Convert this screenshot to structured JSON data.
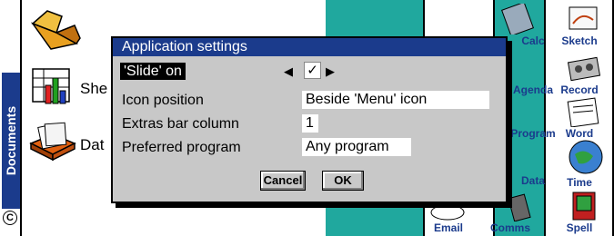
{
  "sidebar": {
    "label": "Documents",
    "corner_badge": "C"
  },
  "files": [
    {
      "label": "She",
      "icon": "spreadsheet-icon"
    },
    {
      "label": "Dat",
      "icon": "database-icon"
    }
  ],
  "folder_icon": "folder-icon",
  "apps": [
    {
      "label": "Calc",
      "icon": "calculator-icon"
    },
    {
      "label": "Sketch",
      "icon": "sketch-icon"
    },
    {
      "label": "Agenda",
      "icon": "agenda-icon"
    },
    {
      "label": "Record",
      "icon": "record-icon"
    },
    {
      "label": "Program",
      "icon": "program-icon"
    },
    {
      "label": "Word",
      "icon": "word-icon"
    },
    {
      "label": "Data",
      "icon": "data-icon"
    },
    {
      "label": "Time",
      "icon": "clock-icon"
    },
    {
      "label": "Email",
      "icon": "email-icon"
    },
    {
      "label": "Comms",
      "icon": "comms-icon"
    },
    {
      "label": "Spell",
      "icon": "spell-icon"
    }
  ],
  "dialog": {
    "title": "Application settings",
    "slide": {
      "label": "'Slide' on",
      "value": "✓"
    },
    "icon_position": {
      "label": "Icon position",
      "value": "Beside 'Menu' icon"
    },
    "extras_bar": {
      "label": "Extras bar column",
      "value": "1"
    },
    "preferred_program": {
      "label": "Preferred program",
      "value": "Any program"
    },
    "cancel_label": "Cancel",
    "ok_label": "OK"
  },
  "colors": {
    "title_bar": "#1b3b8c",
    "dialog_bg": "#c8c8c8",
    "app_bg": "#20a89e"
  }
}
